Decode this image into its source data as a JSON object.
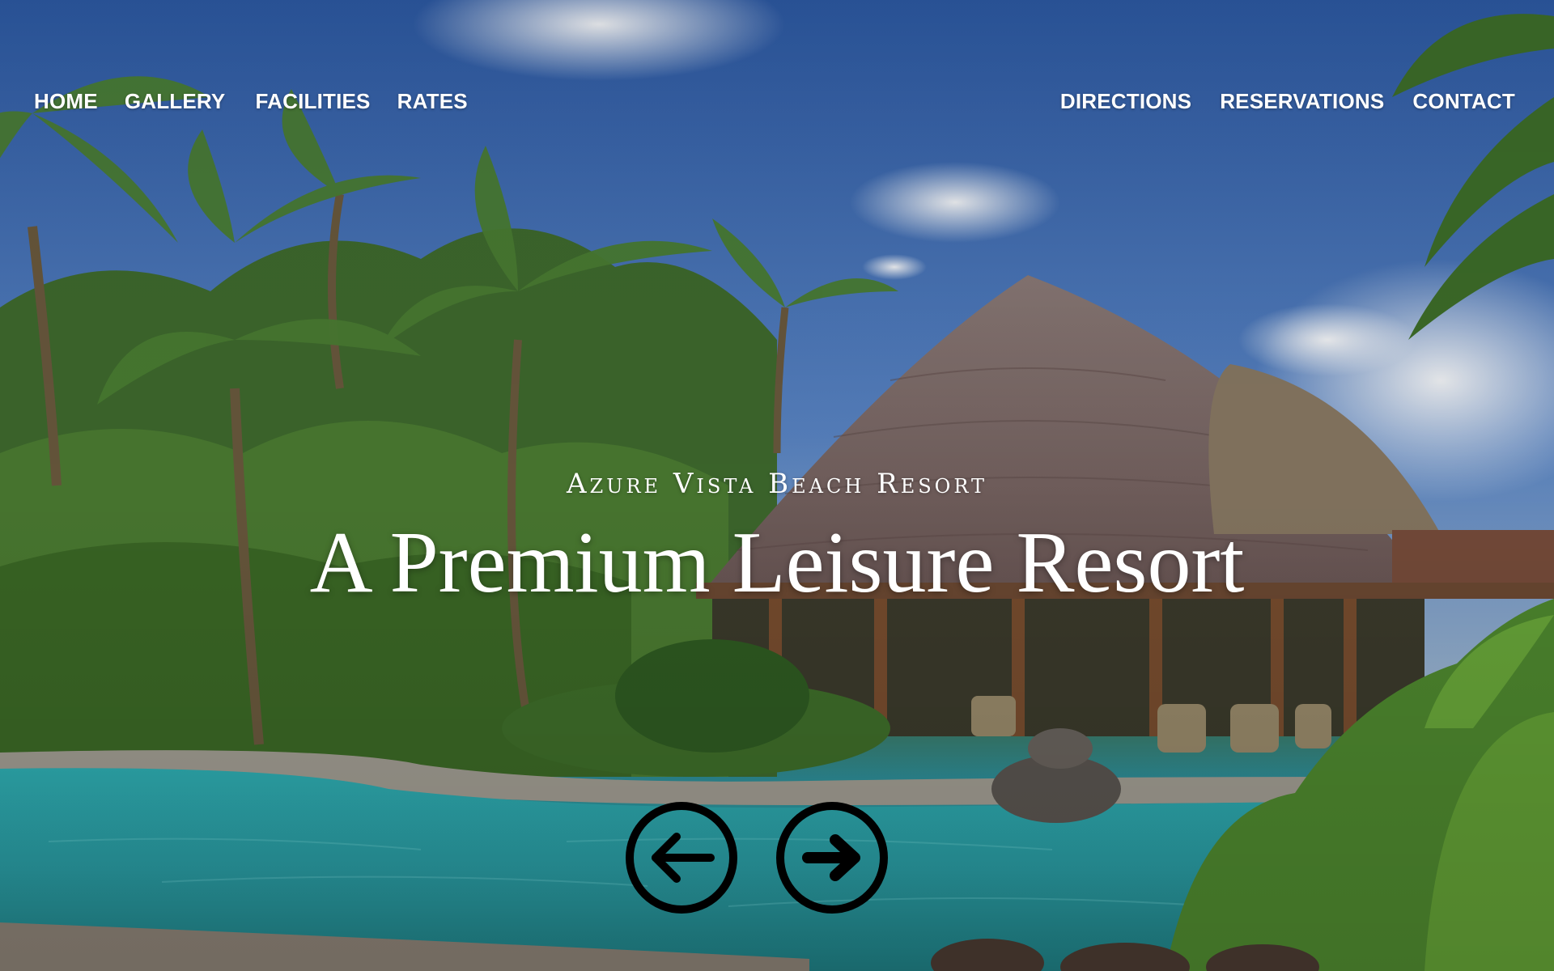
{
  "nav": {
    "left": [
      {
        "id": "home",
        "label": "HOME"
      },
      {
        "id": "gallery",
        "label": "GALLERY"
      },
      {
        "id": "facilities",
        "label": "FACILITIES"
      },
      {
        "id": "rates",
        "label": "RATES"
      }
    ],
    "right": [
      {
        "id": "directions",
        "label": "DIRECTIONS"
      },
      {
        "id": "reservations",
        "label": "RESERVATIONS"
      },
      {
        "id": "contact",
        "label": "CONTACT"
      }
    ]
  },
  "hero": {
    "tagline": "Azure Vista Beach Resort",
    "headline": "A Premium Leisure Resort",
    "background_image": "tropical resort with thatched-roof pavilion, palm trees and swimming pool"
  },
  "slider": {
    "prev_icon": "arrow-left-circle-icon",
    "next_icon": "arrow-right-circle-icon"
  },
  "colors": {
    "nav_text": "#ffffff",
    "headline_text": "#ffffff",
    "slider_icon": "#000000",
    "sky": "#3f6fb8",
    "pool": "#2aa3aa",
    "foliage": "#4a7a34"
  }
}
